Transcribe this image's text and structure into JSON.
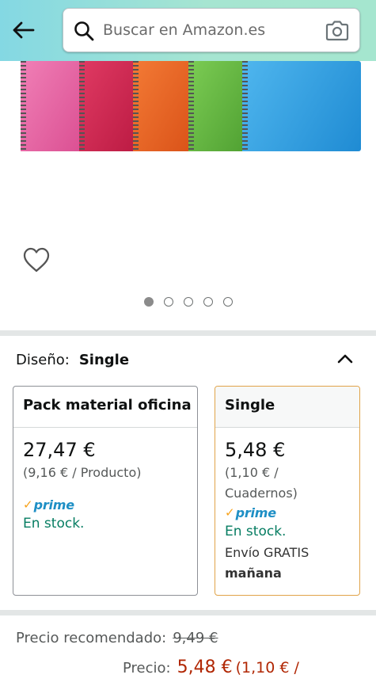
{
  "header": {
    "search_placeholder": "Buscar en Amazon.es",
    "back_icon": "arrow-left-icon",
    "search_icon": "magnifier-icon",
    "camera_icon": "camera-icon",
    "gradient_start": "#84d8e3",
    "gradient_end": "#a5e6cf"
  },
  "gallery": {
    "image_count": 5,
    "active_index": 0,
    "notebook_colors": [
      "#e2609c",
      "#c8214a",
      "#e85f23",
      "#5fae3c",
      "#2f9be0"
    ]
  },
  "design": {
    "label": "Diseño:",
    "value": "Single"
  },
  "options": [
    {
      "title": "Pack material oficina",
      "price": "27,47 €",
      "unit_price": "(9,16 € / Producto)",
      "prime": "prime",
      "stock": "En stock."
    },
    {
      "title": "Single",
      "price": "5,48 €",
      "unit_price_line1": "(1,10 € /",
      "unit_price_line2": "Cuadernos)",
      "prime": "prime",
      "stock": "En stock.",
      "shipping": "Envío GRATIS",
      "shipping_day": "mañana"
    }
  ],
  "pricing": {
    "recommended_label": "Precio recomendado:",
    "recommended_value": "9,49 €",
    "price_label": "Precio:",
    "price_value": "5,48 €",
    "price_unit": "(1,10 € /"
  },
  "colors": {
    "price_red": "#b12704",
    "stock_green": "#067d62",
    "prime_blue": "#1e8fc5",
    "selected_border": "#e0a349"
  }
}
